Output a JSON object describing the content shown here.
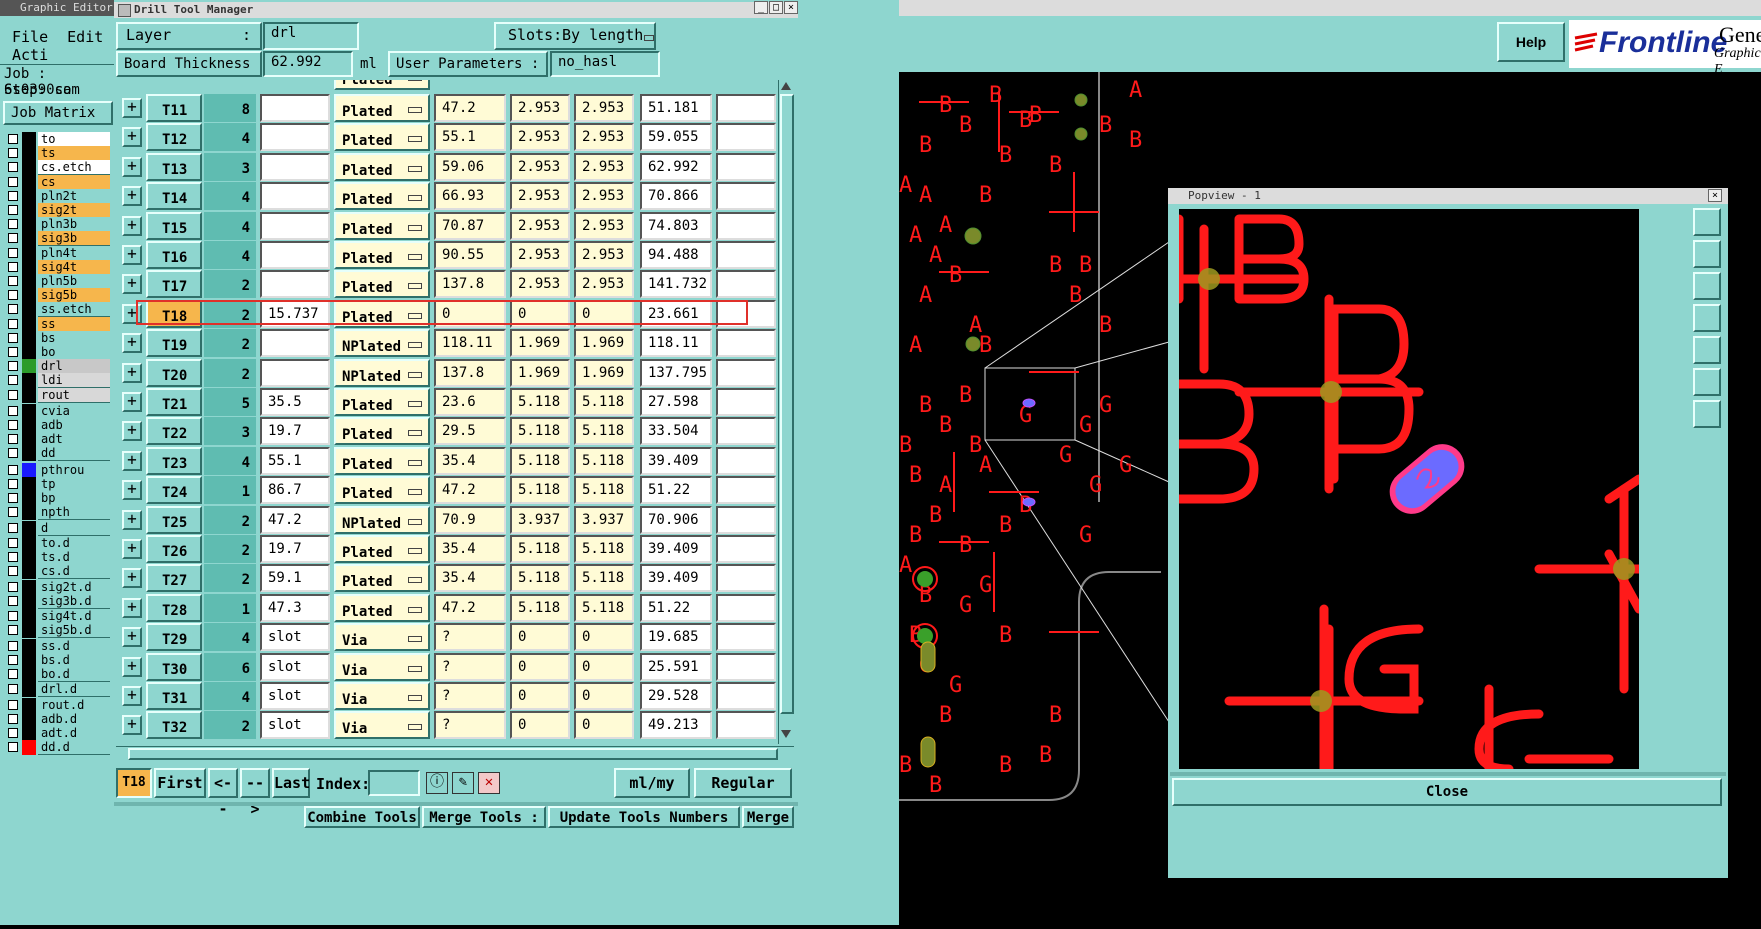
{
  "ge": {
    "title": "Graphic Editor",
    "menu": [
      "File",
      "Edit",
      "Acti"
    ],
    "job": "Job : 6s0390so",
    "step": "Step: cam",
    "job_matrix": "Job Matrix ..",
    "layers": [
      {
        "name": "to",
        "color": "#000000",
        "hl": false
      },
      {
        "name": "ts",
        "color": "#000000",
        "hl": true
      },
      {
        "name": "cs.etch",
        "color": "#000000",
        "hl": false
      },
      {
        "name": "cs",
        "color": "#000000",
        "hl": true
      },
      {
        "name": "pln2t",
        "color": "#000000",
        "hl": false
      },
      {
        "name": "sig2t",
        "color": "#000000",
        "hl": true
      },
      {
        "name": "pln3b",
        "color": "#000000",
        "hl": false
      },
      {
        "name": "sig3b",
        "color": "#000000",
        "hl": true
      },
      {
        "name": "pln4t",
        "color": "#000000",
        "hl": false
      },
      {
        "name": "sig4t",
        "color": "#000000",
        "hl": true
      },
      {
        "name": "pln5b",
        "color": "#000000",
        "hl": false
      },
      {
        "name": "sig5b",
        "color": "#000000",
        "hl": true
      },
      {
        "name": "ss.etch",
        "color": "#000000",
        "hl": false
      },
      {
        "name": "ss",
        "color": "#000000",
        "hl": true
      },
      {
        "name": "bs",
        "color": "#000000",
        "hl": false
      },
      {
        "name": "bo",
        "color": "#000000",
        "hl": false
      },
      {
        "name": "drl",
        "color": "#2b9b2b",
        "hl": false
      },
      {
        "name": "ldi",
        "color": "#000000",
        "hl": false
      },
      {
        "name": "rout",
        "color": "#000000",
        "hl": false
      },
      {
        "name": "cvia",
        "color": "#000000",
        "hl": false
      },
      {
        "name": "adb",
        "color": "#000000",
        "hl": false
      },
      {
        "name": "adt",
        "color": "#000000",
        "hl": false
      },
      {
        "name": "dd",
        "color": "#000000",
        "hl": false
      },
      {
        "name": "pthrou",
        "color": "#1a1aff",
        "hl": false
      },
      {
        "name": "tp",
        "color": "#000000",
        "hl": false
      },
      {
        "name": "bp",
        "color": "#000000",
        "hl": false
      },
      {
        "name": "npth",
        "color": "#000000",
        "hl": false
      },
      {
        "name": "d",
        "color": "#000000",
        "hl": false
      },
      {
        "name": "to.d",
        "color": "#000000",
        "hl": false
      },
      {
        "name": "ts.d",
        "color": "#000000",
        "hl": false
      },
      {
        "name": "cs.d",
        "color": "#000000",
        "hl": false
      },
      {
        "name": "sig2t.d",
        "color": "#000000",
        "hl": false
      },
      {
        "name": "sig3b.d",
        "color": "#000000",
        "hl": false
      },
      {
        "name": "sig4t.d",
        "color": "#000000",
        "hl": false
      },
      {
        "name": "sig5b.d",
        "color": "#000000",
        "hl": false
      },
      {
        "name": "ss.d",
        "color": "#000000",
        "hl": false
      },
      {
        "name": "bs.d",
        "color": "#000000",
        "hl": false
      },
      {
        "name": "bo.d",
        "color": "#000000",
        "hl": false
      },
      {
        "name": "drl.d",
        "color": "#000000",
        "hl": false
      },
      {
        "name": "rout.d",
        "color": "#000000",
        "hl": false
      },
      {
        "name": "adb.d",
        "color": "#000000",
        "hl": false
      },
      {
        "name": "adt.d",
        "color": "#000000",
        "hl": false
      },
      {
        "name": "dd.d",
        "color": "#ff0000",
        "hl": false
      }
    ]
  },
  "dtm": {
    "title": "Drill Tool Manager",
    "layer_label": "Layer",
    "layer_colon": ":",
    "layer_value": "drl",
    "slots_label": "Slots:",
    "slots_value": "By length",
    "thickness_label": "Board Thickness :",
    "thickness_value": "62.992",
    "thickness_unit": "ml",
    "userparam_label": "User Parameters :",
    "userparam_value": "no_hasl",
    "partial_row_text": "Plated",
    "rows": [
      {
        "tool": "T11",
        "count": "8",
        "slot": "",
        "type": "Plated",
        "size": "47.2",
        "p1": "2.953",
        "p2": "2.953",
        "fin": "51.181"
      },
      {
        "tool": "T12",
        "count": "4",
        "slot": "",
        "type": "Plated",
        "size": "55.1",
        "p1": "2.953",
        "p2": "2.953",
        "fin": "59.055"
      },
      {
        "tool": "T13",
        "count": "3",
        "slot": "",
        "type": "Plated",
        "size": "59.06",
        "p1": "2.953",
        "p2": "2.953",
        "fin": "62.992"
      },
      {
        "tool": "T14",
        "count": "4",
        "slot": "",
        "type": "Plated",
        "size": "66.93",
        "p1": "2.953",
        "p2": "2.953",
        "fin": "70.866"
      },
      {
        "tool": "T15",
        "count": "4",
        "slot": "",
        "type": "Plated",
        "size": "70.87",
        "p1": "2.953",
        "p2": "2.953",
        "fin": "74.803"
      },
      {
        "tool": "T16",
        "count": "4",
        "slot": "",
        "type": "Plated",
        "size": "90.55",
        "p1": "2.953",
        "p2": "2.953",
        "fin": "94.488"
      },
      {
        "tool": "T17",
        "count": "2",
        "slot": "",
        "type": "Plated",
        "size": "137.8",
        "p1": "2.953",
        "p2": "2.953",
        "fin": "141.732"
      },
      {
        "tool": "T18",
        "count": "2",
        "slot": "15.737",
        "type": "Plated",
        "size": "0",
        "p1": "0",
        "p2": "0",
        "fin": "23.661"
      },
      {
        "tool": "T19",
        "count": "2",
        "slot": "",
        "type": "NPlated",
        "size": "118.11",
        "p1": "1.969",
        "p2": "1.969",
        "fin": "118.11"
      },
      {
        "tool": "T20",
        "count": "2",
        "slot": "",
        "type": "NPlated",
        "size": "137.8",
        "p1": "1.969",
        "p2": "1.969",
        "fin": "137.795"
      },
      {
        "tool": "T21",
        "count": "5",
        "slot": "35.5",
        "type": "Plated",
        "size": "23.6",
        "p1": "5.118",
        "p2": "5.118",
        "fin": "27.598"
      },
      {
        "tool": "T22",
        "count": "3",
        "slot": "19.7",
        "type": "Plated",
        "size": "29.5",
        "p1": "5.118",
        "p2": "5.118",
        "fin": "33.504"
      },
      {
        "tool": "T23",
        "count": "4",
        "slot": "55.1",
        "type": "Plated",
        "size": "35.4",
        "p1": "5.118",
        "p2": "5.118",
        "fin": "39.409"
      },
      {
        "tool": "T24",
        "count": "1",
        "slot": "86.7",
        "type": "Plated",
        "size": "47.2",
        "p1": "5.118",
        "p2": "5.118",
        "fin": "51.22"
      },
      {
        "tool": "T25",
        "count": "2",
        "slot": "47.2",
        "type": "NPlated",
        "size": "70.9",
        "p1": "3.937",
        "p2": "3.937",
        "fin": "70.906"
      },
      {
        "tool": "T26",
        "count": "2",
        "slot": "19.7",
        "type": "Plated",
        "size": "35.4",
        "p1": "5.118",
        "p2": "5.118",
        "fin": "39.409"
      },
      {
        "tool": "T27",
        "count": "2",
        "slot": "59.1",
        "type": "Plated",
        "size": "35.4",
        "p1": "5.118",
        "p2": "5.118",
        "fin": "39.409"
      },
      {
        "tool": "T28",
        "count": "1",
        "slot": "47.3",
        "type": "Plated",
        "size": "47.2",
        "p1": "5.118",
        "p2": "5.118",
        "fin": "51.22"
      },
      {
        "tool": "T29",
        "count": "4",
        "slot": "slot",
        "type": "Via",
        "size": "?",
        "p1": "0",
        "p2": "0",
        "fin": "19.685"
      },
      {
        "tool": "T30",
        "count": "6",
        "slot": "slot",
        "type": "Via",
        "size": "?",
        "p1": "0",
        "p2": "0",
        "fin": "25.591"
      },
      {
        "tool": "T31",
        "count": "4",
        "slot": "slot",
        "type": "Via",
        "size": "?",
        "p1": "0",
        "p2": "0",
        "fin": "29.528"
      },
      {
        "tool": "T32",
        "count": "2",
        "slot": "slot",
        "type": "Via",
        "size": "?",
        "p1": "0",
        "p2": "0",
        "fin": "49.213"
      }
    ],
    "nav": {
      "current": "T18",
      "first": "First",
      "prev": "<--",
      "next": "-->",
      "last": "Last",
      "index_label": "Index:",
      "units": "ml/my",
      "mode": "Regular"
    },
    "bottom": {
      "combine": "Combine Tools",
      "merge_tools": "Merge Tools :",
      "update": "Update Tools Numbers",
      "merge": "Merge"
    }
  },
  "top": {
    "help": "Help",
    "brand": "Frontline",
    "product": "Genesis",
    "subproduct": "Graphic E"
  },
  "popview": {
    "title": "Popview - 1",
    "close": "Close"
  }
}
